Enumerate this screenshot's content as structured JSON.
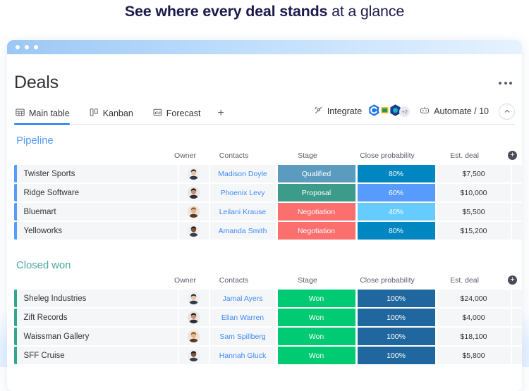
{
  "headline": {
    "bold": "See where every deal stands",
    "light": " at a glance"
  },
  "window": {
    "title": "Deals",
    "menu_icon": "kebab-menu-icon"
  },
  "tabs": [
    {
      "label": "Main table",
      "icon": "table-icon",
      "active": true
    },
    {
      "label": "Kanban",
      "icon": "kanban-icon",
      "active": false
    },
    {
      "label": "Forecast",
      "icon": "forecast-chart-icon",
      "active": false
    }
  ],
  "tab_add_label": "+",
  "toolbar": {
    "integrate_label": "Integrate",
    "integration_overflow": "+2",
    "automate_label": "Automate / 10",
    "collapse_icon": "chevron-up-icon"
  },
  "columns": [
    "",
    "Owner",
    "Contacts",
    "Stage",
    "Close probability",
    "Est. deal"
  ],
  "add_column_label": "+",
  "groups": [
    {
      "title": "Pipeline",
      "color": "#579bfc",
      "bar_color": "#579bfc",
      "rows": [
        {
          "name": "Twister Sports",
          "contact": "Madison Doyle",
          "stage": "Qualified",
          "stage_color": "#5b9bbd",
          "probability": "80%",
          "probability_color": "#0086c0",
          "deal": "$7,500"
        },
        {
          "name": "Ridge Software",
          "contact": "Phoenix Levy",
          "stage": "Proposal",
          "stage_color": "#3d9b8a",
          "probability": "60%",
          "probability_color": "#579bfc",
          "deal": "$10,000"
        },
        {
          "name": "Bluemart",
          "contact": "Leilani Krause",
          "stage": "Negotiation",
          "stage_color": "#fb6f6f",
          "probability": "40%",
          "probability_color": "#66ccff",
          "deal": "$5,500"
        },
        {
          "name": "Yelloworks",
          "contact": "Amanda Smith",
          "stage": "Negotiation",
          "stage_color": "#fb6f6f",
          "probability": "80%",
          "probability_color": "#0086c0",
          "deal": "$15,200"
        }
      ]
    },
    {
      "title": "Closed won",
      "color": "#4bab9c",
      "bar_color": "#35a58f",
      "rows": [
        {
          "name": "Sheleg Industries",
          "contact": "Jamal Ayers",
          "stage": "Won",
          "stage_color": "#00ca72",
          "probability": "100%",
          "probability_color": "#1f679e",
          "deal": "$24,000"
        },
        {
          "name": "Zift Records",
          "contact": "Elian Warren",
          "stage": "Won",
          "stage_color": "#00ca72",
          "probability": "100%",
          "probability_color": "#1f679e",
          "deal": "$4,000"
        },
        {
          "name": "Waissman Gallery",
          "contact": "Sam Spillberg",
          "stage": "Won",
          "stage_color": "#00ca72",
          "probability": "100%",
          "probability_color": "#1f679e",
          "deal": "$18,100"
        },
        {
          "name": "SFF Cruise",
          "contact": "Hannah Gluck",
          "stage": "Won",
          "stage_color": "#00ca72",
          "probability": "100%",
          "probability_color": "#1f679e",
          "deal": "$5,800"
        }
      ]
    }
  ]
}
